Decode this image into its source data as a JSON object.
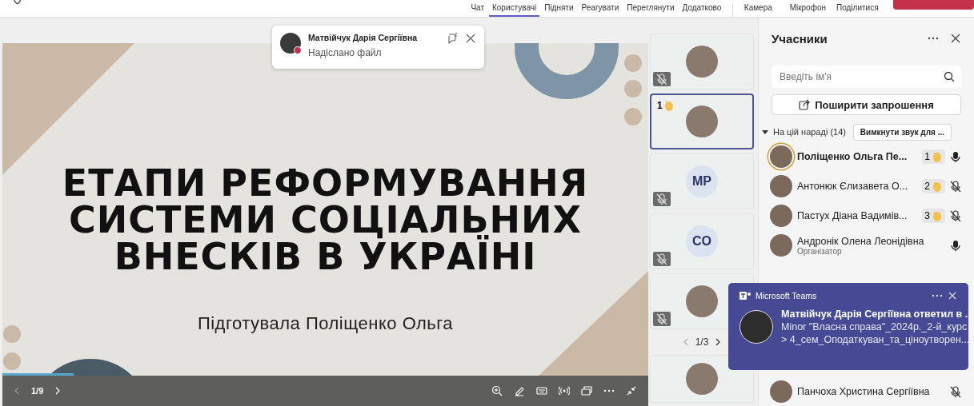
{
  "top_bar": {
    "tabs": [
      {
        "label": "Чат",
        "selected": false
      },
      {
        "label": "Користувачі",
        "selected": true
      },
      {
        "label": "Підняти",
        "selected": false
      },
      {
        "label": "Реагувати",
        "selected": false
      },
      {
        "label": "Переглянути",
        "selected": false
      },
      {
        "label": "Додатково",
        "selected": false
      }
    ],
    "devices": [
      {
        "label": "Камера"
      },
      {
        "label": "Мікрофон"
      },
      {
        "label": "Поділитися"
      }
    ]
  },
  "toast": {
    "sender": "Матвійчук Дарія Сергіївна",
    "message": "Надіслано файл"
  },
  "slide": {
    "title_lines": [
      "ЕТАПИ РЕФОРМУВАННЯ",
      "СИСТЕМИ СОЦІАЛЬНИХ",
      "ВНЕСКІВ В УКРАЇНІ"
    ],
    "subtitle": "Підготувала Поліщенко Ольга",
    "page": "1/9",
    "level": 0.11
  },
  "tiles": [
    {
      "kind": "photo",
      "muted": true,
      "selected": false
    },
    {
      "kind": "photo",
      "muted": false,
      "selected": true,
      "hand": "1"
    },
    {
      "kind": "initials",
      "initials": "MP",
      "muted": true,
      "selected": false
    },
    {
      "kind": "initials",
      "initials": "CO",
      "muted": true,
      "selected": false
    },
    {
      "kind": "photo",
      "muted": true,
      "selected": false
    },
    {
      "kind": "photo",
      "muted": false,
      "selected": false
    }
  ],
  "tiles_pager": "1/3",
  "panel": {
    "title": "Учасники",
    "search_placeholder": "Введіть ім'я",
    "invite_button": "Поширити запрошення",
    "section": {
      "label": "На цій нараді (14)",
      "expanded": true,
      "mute_all_button": "Вимкнути звук для ..."
    },
    "participants": [
      {
        "name": "Поліщенко Ольга Пе...",
        "hand": "1",
        "muted": false,
        "speaking": true
      },
      {
        "name": "Антонюк Єлизавета О...",
        "hand": "2",
        "muted": true,
        "speaking": false
      },
      {
        "name": "Пастух Діана Вадимів...",
        "hand": "3",
        "muted": true,
        "speaking": false
      },
      {
        "name": "Андронік Олена Леонідівна",
        "role": "Організатор",
        "muted": false,
        "speaking": false
      },
      {
        "name": "Панчоха Христина Сергіївна",
        "muted": true,
        "speaking": false
      }
    ]
  },
  "teams_notification": {
    "app": "Microsoft Teams",
    "title": "Матвійчук Дарія Сергіївна ответил в ...",
    "lines": [
      "Minor \"Власна справа\"_2024р._2-й_курс",
      "> 4_сем_Оподаткуван_та_ціноутворен..."
    ]
  }
}
